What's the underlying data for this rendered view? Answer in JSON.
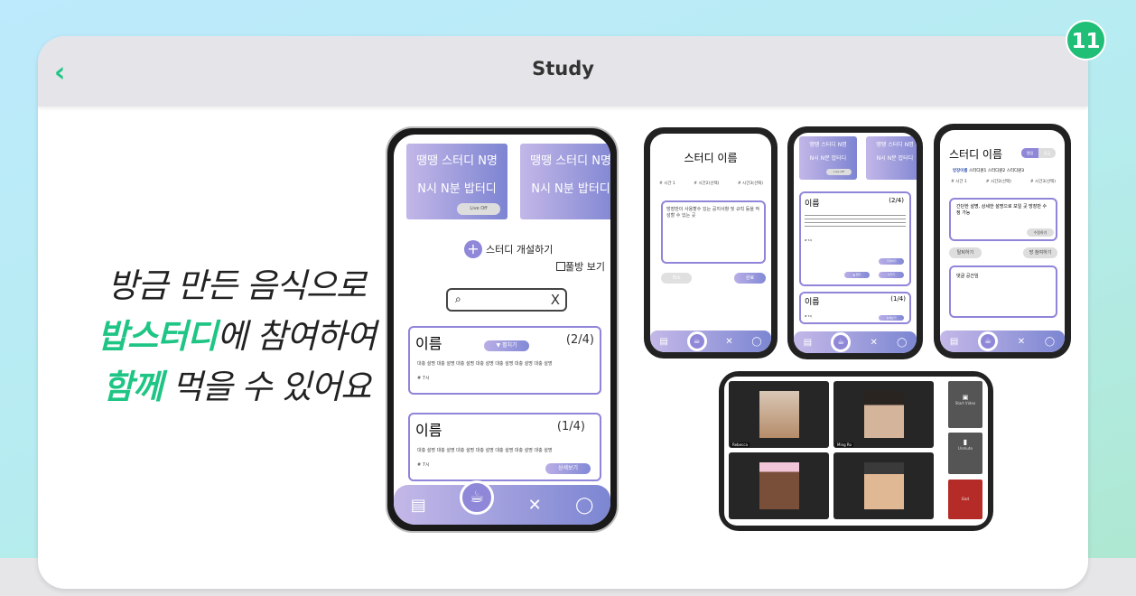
{
  "page": {
    "title": "Study",
    "badge": "11",
    "back_icon": "chevron-left-icon",
    "accent": "#1fc584"
  },
  "slogan": {
    "line1": "방금 만든 음식으로",
    "line2_accent": "밥스터디",
    "line2_rest": "에 참여하여",
    "line3_accent": "함께",
    "line3_rest": " 먹을 수 있어요"
  },
  "main_phone": {
    "banners": [
      {
        "line1": "땡땡 스터디  N명",
        "line2": "N시 N분 밥터디",
        "button": "Live Off"
      },
      {
        "line1": "땡땡 스터디  N명",
        "line2": "N시 N분 밥터디"
      }
    ],
    "create_label": "스터디 개설하기",
    "full_room_label": "풀방 보기",
    "search_clear": "X",
    "rooms": [
      {
        "name": "이름",
        "count": "(2/4)",
        "expand": "▼ 펼치기",
        "desc": "대충 설명 대충 설명 대충 설명 대충 설명 대충 설명 대충 설명 대충 설명",
        "time": "# 7시"
      },
      {
        "name": "이름",
        "count": "(1/4)",
        "desc": "대충 설명 대충 설명 대충 설명 대충 설명 대충 설명 대충 설명 대충 설명",
        "time": "# 7시",
        "detail": "상세보기"
      }
    ],
    "nav": [
      "fridge-icon",
      "cup-icon",
      "utensils-icon",
      "chat-icon"
    ]
  },
  "create_phone": {
    "title": "스터디 이름",
    "tags": [
      "# 시간 1",
      "# 시간2(선택)",
      "# 시간3(선택)"
    ],
    "notice": "방장만이 사용할수 있는 공지사항 및 규칙 등을 작성할 수 있는 곳",
    "cancel": "취소",
    "done": "완료"
  },
  "list_phone": {
    "banners": [
      {
        "line1": "땡땡 스터디  N명",
        "line2": "N시 N분 밥터디",
        "button": "Live Off"
      },
      {
        "line1": "땡땡 스터디  N명",
        "line2": "N시 N분 밥터디"
      }
    ],
    "rooms": [
      {
        "name": "이름",
        "count": "(2/4)",
        "time": "# 7시",
        "join": "가입하기",
        "fold": "▲ 접기",
        "leave": "나가기"
      },
      {
        "name": "이름",
        "count": "(1/4)",
        "time": "# 7시",
        "detail": "상세보기"
      }
    ]
  },
  "detail_phone": {
    "title": "스터디 이름",
    "toggle": [
      "열림",
      "잠금"
    ],
    "host": "방장이름",
    "members": "스터디원1 스터디원2 스터디원3",
    "tags": [
      "# 시간 1",
      "# 시간2(선택)",
      "# 시간3(선택)"
    ],
    "desc": "간단한 설명, 상세한 설명으로 보일 곳 방장만 수정 가능",
    "edit": "수정하기",
    "leave": "탈퇴하기",
    "join": "방 참여하기",
    "comments": "댓글 공간임"
  },
  "video_call": {
    "participants": [
      "Rebecca",
      "Ming Ro",
      "",
      ""
    ],
    "start_video": "Start Video",
    "unmute": "Unmute",
    "end": "End",
    "end_color": "#b52b27"
  }
}
